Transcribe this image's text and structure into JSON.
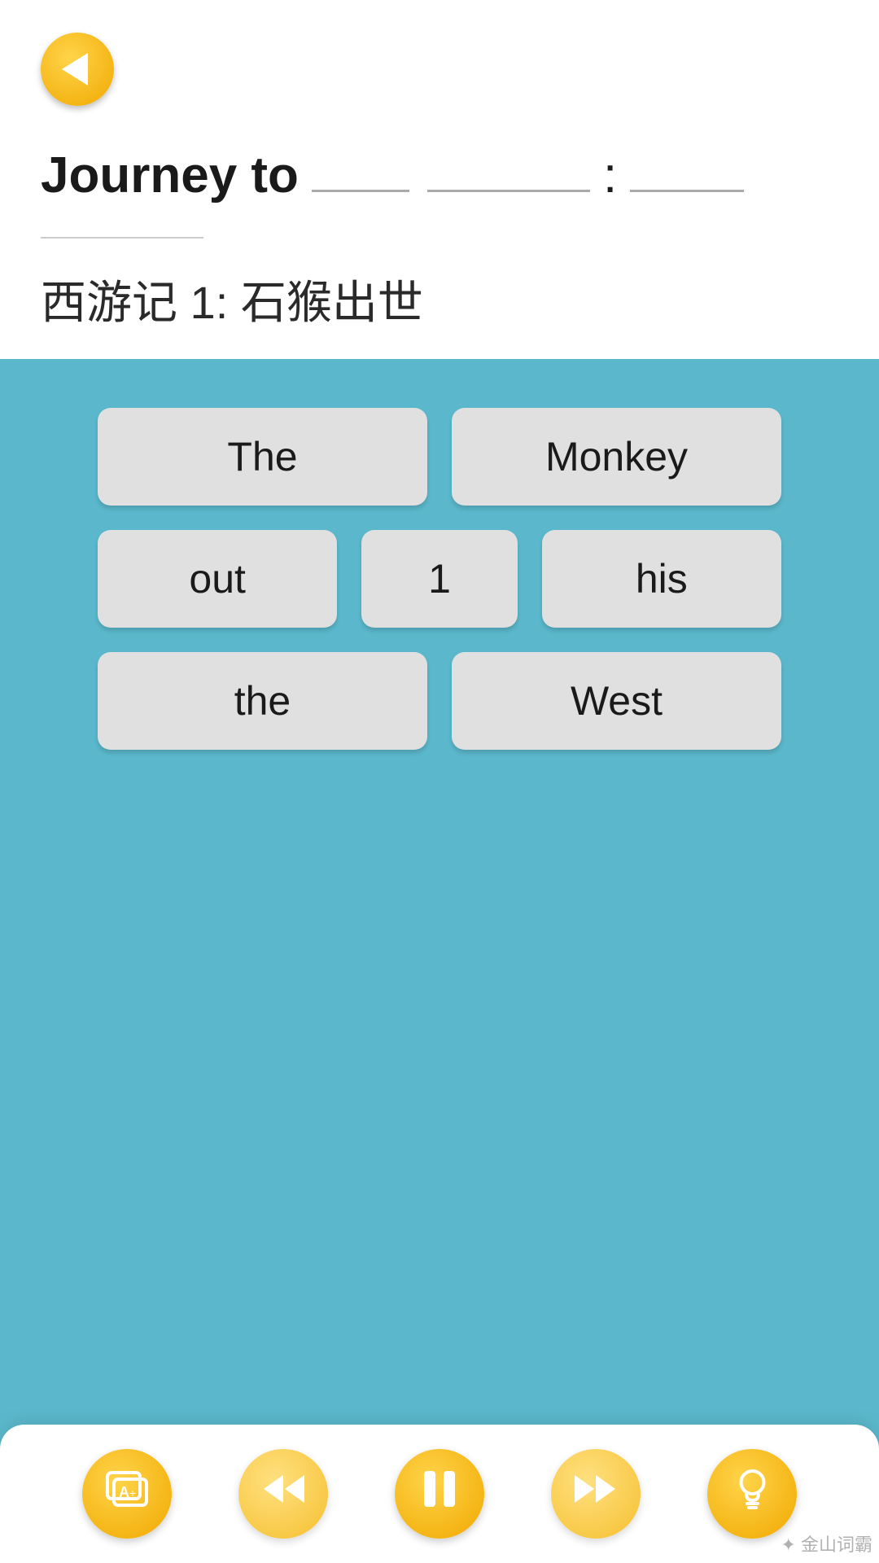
{
  "header": {
    "back_label": "←",
    "title_prefix": "Journey to",
    "colon": ":",
    "subtitle_chinese": "西游记 1: 石猴出世"
  },
  "word_tiles": {
    "row1": [
      {
        "id": "tile-the-cap",
        "label": "The"
      },
      {
        "id": "tile-monkey",
        "label": "Monkey"
      }
    ],
    "row2": [
      {
        "id": "tile-out",
        "label": "out"
      },
      {
        "id": "tile-1",
        "label": "1"
      },
      {
        "id": "tile-his",
        "label": "his"
      }
    ],
    "row3": [
      {
        "id": "tile-the-low",
        "label": "the"
      },
      {
        "id": "tile-west",
        "label": "West"
      }
    ]
  },
  "toolbar": {
    "flashcard_label": "🃏",
    "rewind_label": "⏮",
    "pause_label": "⏸",
    "forward_label": "⏭",
    "bulb_label": "💡"
  },
  "watermark": "✦ 金山词霸"
}
